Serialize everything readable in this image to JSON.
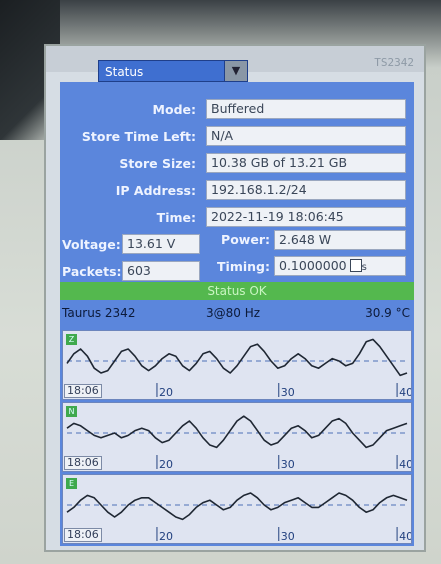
{
  "header": {
    "view_select": "Status",
    "device_id": "TS2342"
  },
  "fields": {
    "mode": {
      "label": "Mode:",
      "value": "Buffered"
    },
    "store_time_left": {
      "label": "Store Time Left:",
      "value": "N/A"
    },
    "store_size": {
      "label": "Store Size:",
      "value": "10.38 GB  of  13.21 GB"
    },
    "ip_address": {
      "label": "IP Address:",
      "value": "192.168.1.2/24"
    },
    "time": {
      "label": "Time:",
      "value": "2022-11-19 18:06:45"
    },
    "voltage": {
      "label": "Voltage:",
      "value": "13.61 V"
    },
    "power": {
      "label": "Power:",
      "value": "2.648 W"
    },
    "packets": {
      "label": "Packets:",
      "value": "603"
    },
    "timing": {
      "label": "Timing:",
      "value": "0.1000000",
      "unit": "s"
    }
  },
  "status": {
    "text": "Status OK",
    "device_name": "Taurus 2342",
    "rate": "3@80 Hz",
    "temperature": "30.9 °C"
  },
  "colors": {
    "panel": "#5b86dc",
    "status_ok": "#54b84e",
    "trace": "#1f2733",
    "tag": "#3fa94d"
  },
  "chart_data": [
    {
      "type": "line",
      "channel": "Z",
      "x_start_label": "18:06",
      "x_ticks": [
        "20",
        "30",
        "40"
      ],
      "x": [
        0,
        1,
        2,
        3,
        4,
        5,
        6,
        7,
        8,
        9,
        10,
        11,
        12,
        13,
        14,
        15,
        16,
        17,
        18,
        19,
        20,
        21,
        22,
        23,
        24,
        25,
        26,
        27,
        28,
        29,
        30,
        31,
        32,
        33,
        34,
        35,
        36,
        37,
        38,
        39,
        40,
        41,
        42,
        43,
        44,
        45,
        46,
        47,
        48,
        49,
        50
      ],
      "values": [
        -0.1,
        0.3,
        0.5,
        0.2,
        -0.3,
        -0.5,
        -0.4,
        0.0,
        0.4,
        0.5,
        0.2,
        -0.2,
        -0.4,
        -0.2,
        0.1,
        0.3,
        0.2,
        -0.2,
        -0.4,
        -0.1,
        0.3,
        0.4,
        0.1,
        -0.3,
        -0.5,
        -0.2,
        0.2,
        0.6,
        0.7,
        0.4,
        0.0,
        -0.3,
        -0.2,
        0.1,
        0.3,
        0.1,
        -0.2,
        -0.3,
        -0.1,
        0.1,
        0.0,
        -0.2,
        -0.1,
        0.3,
        0.8,
        0.9,
        0.6,
        0.2,
        -0.2,
        -0.6,
        -0.5
      ],
      "ylim": [
        -1,
        1
      ],
      "reference_line": 0
    },
    {
      "type": "line",
      "channel": "N",
      "x_start_label": "18:06",
      "x_ticks": [
        "20",
        "30",
        "40"
      ],
      "x": [
        0,
        1,
        2,
        3,
        4,
        5,
        6,
        7,
        8,
        9,
        10,
        11,
        12,
        13,
        14,
        15,
        16,
        17,
        18,
        19,
        20,
        21,
        22,
        23,
        24,
        25,
        26,
        27,
        28,
        29,
        30,
        31,
        32,
        33,
        34,
        35,
        36,
        37,
        38,
        39,
        40,
        41,
        42,
        43,
        44,
        45,
        46,
        47,
        48,
        49,
        50
      ],
      "values": [
        0.2,
        0.4,
        0.3,
        0.1,
        -0.1,
        -0.2,
        -0.1,
        0.0,
        -0.2,
        -0.1,
        0.1,
        0.2,
        0.1,
        -0.2,
        -0.4,
        -0.3,
        0.0,
        0.3,
        0.5,
        0.2,
        -0.2,
        -0.5,
        -0.6,
        -0.3,
        0.1,
        0.5,
        0.7,
        0.5,
        0.1,
        -0.3,
        -0.5,
        -0.4,
        -0.1,
        0.2,
        0.3,
        0.1,
        -0.2,
        -0.1,
        0.2,
        0.5,
        0.6,
        0.4,
        0.0,
        -0.3,
        -0.6,
        -0.5,
        -0.2,
        0.1,
        0.2,
        0.3,
        0.4
      ],
      "ylim": [
        -1,
        1
      ],
      "reference_line": 0
    },
    {
      "type": "line",
      "channel": "E",
      "x_start_label": "18:06",
      "x_ticks": [
        "20",
        "30",
        "40"
      ],
      "x": [
        0,
        1,
        2,
        3,
        4,
        5,
        6,
        7,
        8,
        9,
        10,
        11,
        12,
        13,
        14,
        15,
        16,
        17,
        18,
        19,
        20,
        21,
        22,
        23,
        24,
        25,
        26,
        27,
        28,
        29,
        30,
        31,
        32,
        33,
        34,
        35,
        36,
        37,
        38,
        39,
        40,
        41,
        42,
        43,
        44,
        45,
        46,
        47,
        48,
        49,
        50
      ],
      "values": [
        -0.3,
        -0.1,
        0.2,
        0.4,
        0.3,
        0.0,
        -0.3,
        -0.5,
        -0.3,
        0.0,
        0.2,
        0.3,
        0.3,
        0.1,
        -0.1,
        -0.3,
        -0.5,
        -0.6,
        -0.4,
        -0.1,
        0.1,
        0.2,
        0.0,
        -0.2,
        -0.1,
        0.2,
        0.4,
        0.5,
        0.3,
        0.0,
        -0.2,
        -0.1,
        0.1,
        0.2,
        0.3,
        0.1,
        -0.1,
        -0.1,
        0.1,
        0.3,
        0.5,
        0.4,
        0.2,
        -0.1,
        -0.3,
        -0.2,
        0.1,
        0.3,
        0.4,
        0.3,
        0.2
      ],
      "ylim": [
        -1,
        1
      ],
      "reference_line": 0
    }
  ]
}
